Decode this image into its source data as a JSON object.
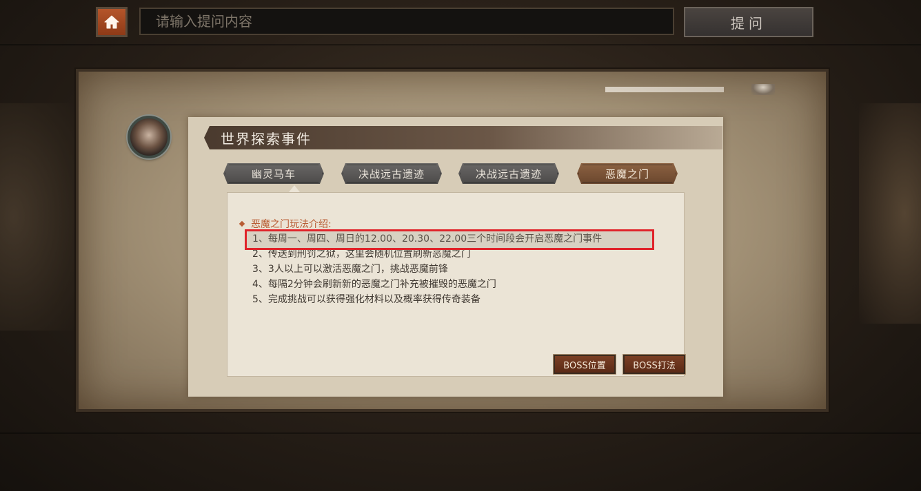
{
  "search": {
    "placeholder": "请输入提问内容",
    "ask_label": "提问"
  },
  "panel": {
    "title": "世界探索事件",
    "tabs": [
      {
        "label": "幽灵马车",
        "active": false
      },
      {
        "label": "决战远古遗迹",
        "active": false
      },
      {
        "label": "决战远古遗迹",
        "active": false
      },
      {
        "label": "恶魔之门",
        "active": true
      }
    ],
    "content": {
      "heading": "恶魔之门玩法介绍:",
      "rules": [
        "1、每周一、周四、周日的12.00、20.30、22.00三个时间段会开启恶魔之门事件",
        "2、传送到刑罚之狱，这里会随机位置刷新恶魔之门",
        "3、3人以上可以激活恶魔之门，挑战恶魔前锋",
        "4、每隔2分钟会刷新新的恶魔之门补充被摧毁的恶魔之门",
        "5、完成挑战可以获得强化材料以及概率获得传奇装备"
      ]
    },
    "buttons": {
      "boss_location": "BOSS位置",
      "boss_strategy": "BOSS打法"
    }
  },
  "colors": {
    "highlight_border": "#e0232a",
    "heading_accent": "#b85c34",
    "home_button": "#b5552a",
    "active_tab": "#8c6242"
  },
  "icons": {
    "home": "home-icon",
    "bullet": "diamond-icon"
  }
}
